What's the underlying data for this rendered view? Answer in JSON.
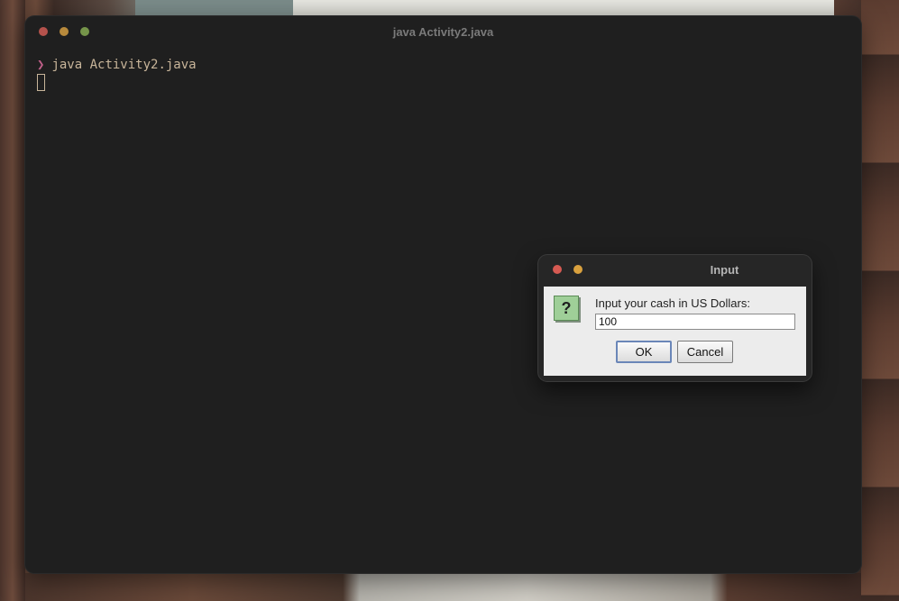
{
  "terminal": {
    "title": "java Activity2.java",
    "prompt_symbol": "❯",
    "command": "java Activity2.java"
  },
  "dialog": {
    "title": "Input",
    "icon": "question-icon",
    "icon_glyph": "?",
    "label": "Input your cash in US Dollars:",
    "input_value": "100",
    "ok_label": "OK",
    "cancel_label": "Cancel"
  }
}
